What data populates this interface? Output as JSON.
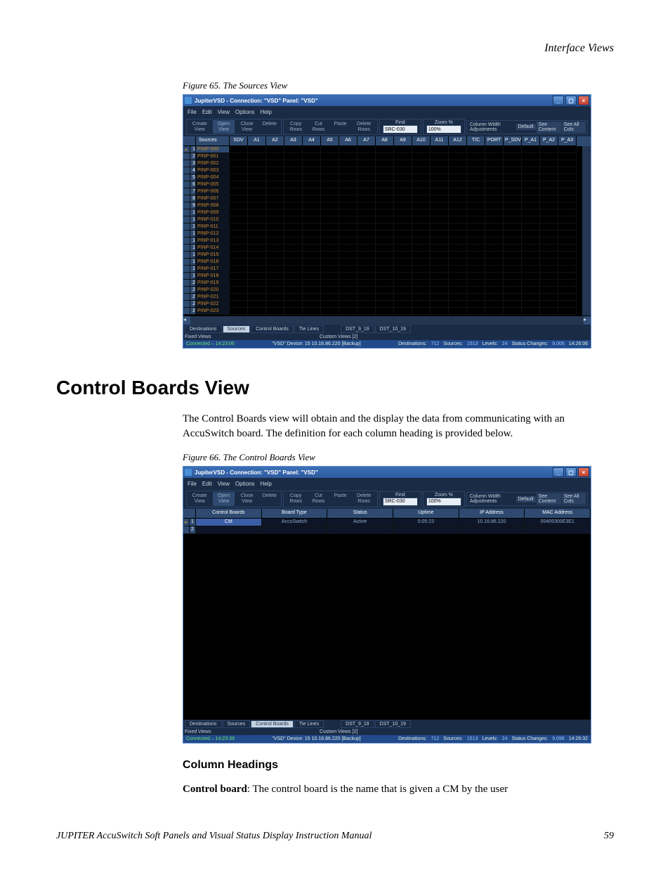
{
  "page_header": "Interface Views",
  "figure65_caption": "Figure 65.  The Sources View",
  "figure66_caption": "Figure 66.  The Control Boards View",
  "app_window": {
    "title": "JupiterVSD - Connection: \"VSD\"  Panel: \"VSD\"",
    "menus": [
      "File",
      "Edit",
      "View",
      "Options",
      "Help"
    ],
    "toolbar_left": [
      "Create View",
      "Open View",
      "Close View",
      "Delete"
    ],
    "toolbar_rows": [
      "Copy Rows",
      "Cut Rows",
      "Paste",
      "Delete Rows"
    ],
    "find_label": "Find",
    "find_value": "SRC-030",
    "zoom_label": "Zoom %",
    "zoom_value": "100%",
    "cwa": {
      "label": "Column Width Adjustments",
      "buttons": [
        "Default",
        "See Content",
        "See All Cols"
      ]
    }
  },
  "sources_grid": {
    "columns": [
      "Sources",
      "SDV",
      "A1",
      "A2",
      "A3",
      "A4",
      "A5",
      "A6",
      "A7",
      "A8",
      "A9",
      "A10",
      "A11",
      "A12",
      "T/C",
      "PORT",
      "P_SDV",
      "P_A1",
      "P_A2",
      "P_A3"
    ],
    "rows": [
      {
        "idx": 1,
        "name": "PINP-000"
      },
      {
        "idx": 2,
        "name": "PINP-001"
      },
      {
        "idx": 3,
        "name": "PINP-002"
      },
      {
        "idx": 4,
        "name": "PINP-003"
      },
      {
        "idx": 5,
        "name": "PINP-004"
      },
      {
        "idx": 6,
        "name": "PINP-005"
      },
      {
        "idx": 7,
        "name": "PINP-006"
      },
      {
        "idx": 8,
        "name": "PINP-007"
      },
      {
        "idx": 9,
        "name": "PINP-008"
      },
      {
        "idx": 1,
        "name": "PINP-009"
      },
      {
        "idx": 1,
        "name": "PINP-010"
      },
      {
        "idx": 1,
        "name": "PINP-011"
      },
      {
        "idx": 1,
        "name": "PINP-012"
      },
      {
        "idx": 1,
        "name": "PINP-013"
      },
      {
        "idx": 1,
        "name": "PINP-014"
      },
      {
        "idx": 1,
        "name": "PINP-015"
      },
      {
        "idx": 1,
        "name": "PINP-016"
      },
      {
        "idx": 1,
        "name": "PINP-017"
      },
      {
        "idx": 1,
        "name": "PINP-018"
      },
      {
        "idx": 2,
        "name": "PINP-019"
      },
      {
        "idx": 2,
        "name": "PINP-020"
      },
      {
        "idx": 2,
        "name": "PINP-021"
      },
      {
        "idx": 2,
        "name": "PINP-022"
      },
      {
        "idx": 2,
        "name": "PINP-023"
      }
    ]
  },
  "control_boards_grid": {
    "columns": [
      "Control Boards",
      "Board Type",
      "Status",
      "Uptime",
      "IP Address",
      "MAC Address"
    ],
    "rows": [
      {
        "idx": 1,
        "cells": [
          "CM",
          "AccuSwitch",
          "Active",
          "0:05:23",
          "10.16.86.220",
          "00405300E3E1"
        ]
      },
      {
        "idx": 2,
        "cells": [
          "",
          "",
          "",
          "",
          "",
          ""
        ]
      }
    ]
  },
  "tabs": {
    "fixed": [
      "Destinations",
      "Sources",
      "Control Boards",
      "Tie Lines"
    ],
    "custom": [
      "DST_9_19",
      "DST_10_19"
    ],
    "fixed_label": "Fixed Views",
    "custom_label": "Custom Views [2]"
  },
  "statusbar": {
    "connected": "Connected – 14:23:06",
    "device": "\"VSD\" Device: 15   10.16.86.220 [Backup]",
    "dest_label": "Destinations:",
    "dest_value": "712",
    "src_label": "Sources:",
    "src_value": "1513",
    "lvl_label": "Levels:",
    "lvl_value": "24",
    "sc_label": "Status Changes:",
    "sc_value": "9,006",
    "time_a": "14:26:06",
    "sc_value_b": "9,096",
    "time_b": "14:26:32",
    "connected_b": "Connected – 14:23:39"
  },
  "section_title": "Control Boards View",
  "body_para": "The Control Boards view will obtain and the display the data from communicating with an AccuSwitch board. The definition for each column heading is provided below.",
  "subsection": "Column Headings",
  "cb_line_strong": "Control board",
  "cb_line_rest": ": The control board is the name that is given a CM by the user",
  "footer_left": "JUPITER AccuSwitch Soft Panels and Visual Status Display Instruction Manual",
  "footer_page": "59"
}
